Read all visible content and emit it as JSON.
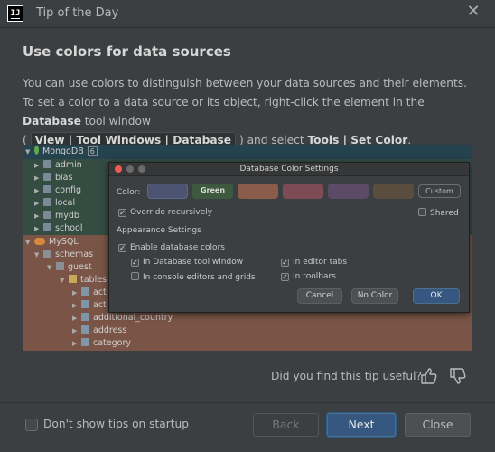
{
  "window": {
    "title": "Tip of the Day",
    "app_icon_text": "IJ"
  },
  "tip": {
    "heading": "Use colors for data sources",
    "body_1": "You can use colors to distinguish between your data sources and their elements. To set a color to a data source or its object, right-click the element in the ",
    "body_bold_1": "Database",
    "body_2": " tool window",
    "paren_open": "(",
    "chip": "View | Tool Windows | Database",
    "paren_close": ")",
    "body_3": " and select ",
    "body_bold_2": "Tools | Set Color",
    "body_4": "."
  },
  "illustration": {
    "tree": {
      "mongo_root": "MongoDB",
      "mongo_badge": "6",
      "mongo_items": [
        "admin",
        "bias",
        "config",
        "local",
        "mydb",
        "school"
      ],
      "mysql_root": "MySQL",
      "schemas": "schemas",
      "guest": "guest",
      "tables": "tables",
      "partial_tables": [
        "act",
        "act"
      ],
      "tables_list": [
        "additional_country",
        "address",
        "category"
      ]
    },
    "dialog": {
      "title": "Database Color Settings",
      "color_label": "Color:",
      "swatches": [
        {
          "color": "#4c5471",
          "label": ""
        },
        {
          "color": "#3e5a3e",
          "label": "Green"
        },
        {
          "color": "#8c5c4a",
          "label": ""
        },
        {
          "color": "#7d4b53",
          "label": ""
        },
        {
          "color": "#5c4b66",
          "label": ""
        },
        {
          "color": "#5a4d3e",
          "label": ""
        }
      ],
      "custom_label": "Custom",
      "override": "Override recursively",
      "shared": "Shared",
      "appearance_section": "Appearance Settings",
      "enable_colors": "Enable database colors",
      "in_db_tool_window": "In Database tool window",
      "in_editor_tabs": "In editor tabs",
      "in_console": "In console editors and grids",
      "in_toolbars": "In toolbars",
      "cancel": "Cancel",
      "no_color": "No Color",
      "ok": "OK"
    }
  },
  "feedback": {
    "question": "Did you find this tip useful?"
  },
  "footer": {
    "dont_show": "Don't show tips on startup",
    "back": "Back",
    "next": "Next",
    "close": "Close"
  },
  "colors": {
    "accent": "#365880",
    "mongo_band": "#344c42",
    "mysql_band": "#7a5547"
  }
}
